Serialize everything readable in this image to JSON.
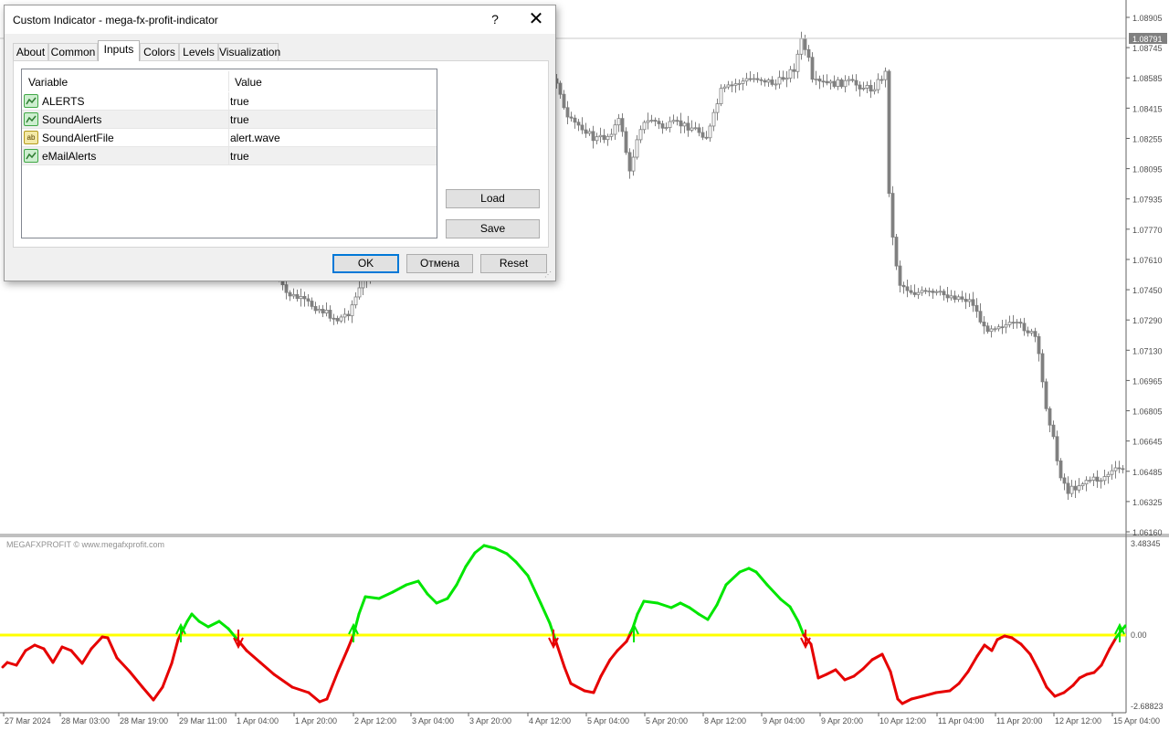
{
  "chart": {
    "price_scale": [
      "1.08905",
      "1.08745",
      "1.08585",
      "1.08415",
      "1.08255",
      "1.08095",
      "1.07935",
      "1.07770",
      "1.07610",
      "1.07450",
      "1.07290",
      "1.07130",
      "1.06965",
      "1.06805",
      "1.06645",
      "1.06485",
      "1.06325",
      "1.06160"
    ],
    "current_price": "1.08791",
    "indicator_label": "MEGAFXPROFIT © www.megafxprofit.com",
    "indicator_scale": [
      "3.48345",
      "0.00",
      "-2.68823"
    ],
    "time_labels": [
      "27 Mar 2024",
      "28 Mar 03:00",
      "28 Mar 19:00",
      "29 Mar 11:00",
      "1 Apr 04:00",
      "1 Apr 20:00",
      "2 Apr 12:00",
      "3 Apr 04:00",
      "3 Apr 20:00",
      "4 Apr 12:00",
      "5 Apr 04:00",
      "5 Apr 20:00",
      "8 Apr 12:00",
      "9 Apr 04:00",
      "9 Apr 20:00",
      "10 Apr 12:00",
      "11 Apr 04:00",
      "11 Apr 20:00",
      "12 Apr 12:00",
      "15 Apr 04:00"
    ],
    "colors": {
      "zero_line": "#ffff00",
      "up": "#00e600",
      "down": "#e60000",
      "candle": "#808080",
      "grid": "#c8c8c8"
    }
  },
  "dialog": {
    "title": "Custom Indicator - mega-fx-profit-indicator",
    "help": "?",
    "close": "✕",
    "tabs": [
      "About",
      "Common",
      "Inputs",
      "Colors",
      "Levels",
      "Visualization"
    ],
    "active_tab": "Inputs",
    "columns": {
      "variable": "Variable",
      "value": "Value"
    },
    "inputs": [
      {
        "icon": "bool-icon",
        "name": "ALERTS",
        "value": "true"
      },
      {
        "icon": "bool-icon",
        "name": "SoundAlerts",
        "value": "true"
      },
      {
        "icon": "string-icon",
        "icon_text": "ab",
        "name": "SoundAlertFile",
        "value": "alert.wave"
      },
      {
        "icon": "bool-icon",
        "name": "eMailAlerts",
        "value": "true"
      }
    ],
    "load": "Load",
    "save": "Save",
    "ok": "OK",
    "cancel": "Отмена",
    "reset": "Reset"
  }
}
